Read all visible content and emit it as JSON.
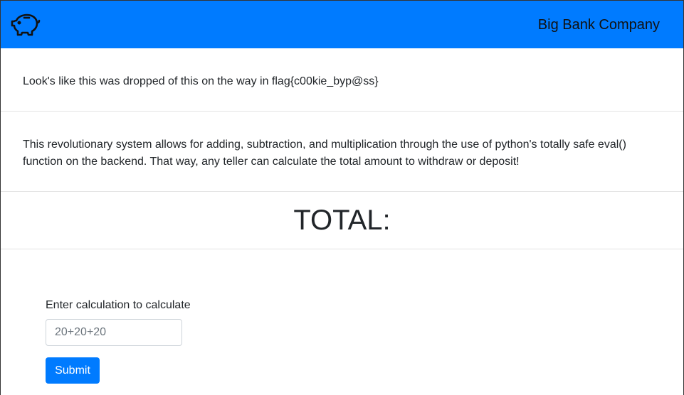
{
  "navbar": {
    "logo_icon": "piggy-bank-icon",
    "brand": "Big Bank Company",
    "background": "#007bff"
  },
  "flag_message": "Look's like this was dropped of this on the way in flag{c00kie_byp@ss}",
  "info_message": "This revolutionary system allows for adding, subtraction, and multiplication through the use of python's totally safe eval() function on the backend. That way, any teller can calculate the total amount to withdraw or deposit!",
  "total": {
    "title": "TOTAL:"
  },
  "form": {
    "label": "Enter calculation to calculate",
    "input_placeholder": "20+20+20",
    "input_value": "",
    "submit_label": "Submit",
    "submit_color": "#007bff"
  }
}
